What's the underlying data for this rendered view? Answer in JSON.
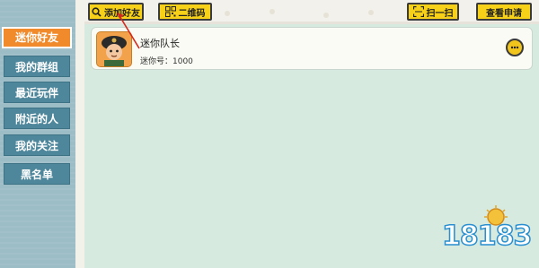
{
  "sidebar": {
    "items": [
      {
        "label": "迷你好友",
        "active": true
      },
      {
        "label": "我的群组"
      },
      {
        "label": "最近玩伴"
      },
      {
        "label": "附近的人"
      },
      {
        "label": "我的关注"
      },
      {
        "label": "黑名单"
      }
    ]
  },
  "toolbar": {
    "add_friend_label": "添加好友",
    "qr_label": "二维码",
    "scan_label": "扫一扫",
    "view_requests_label": "查看申请"
  },
  "friend": {
    "name": "迷你队长",
    "mini_id": "迷你号：1000"
  },
  "watermark": {
    "text": "18183"
  },
  "colors": {
    "accent": "#f08a2b",
    "button": "#f7d117",
    "sidebar_item": "#4e879b",
    "content_bg": "#d6eadf"
  }
}
